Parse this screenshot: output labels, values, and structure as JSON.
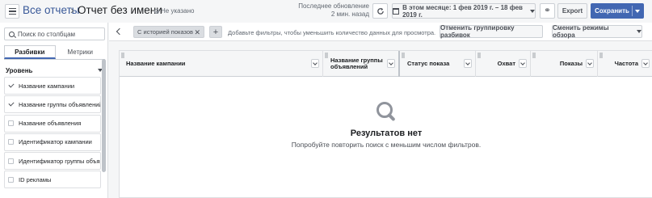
{
  "header": {
    "breadcrumb_link": "Все отчеты",
    "breadcrumb_sep": "›",
    "title": "Отчет без имени",
    "status": "Не указано",
    "updated_line1": "Последнее обновление",
    "updated_line2": "2 мин. назад",
    "date_range": "В этом месяце: 1 фев 2019 г. – 18 фев 2019 г.",
    "link_icon": "⚭",
    "export_label": "Export",
    "save_label": "Сохранить"
  },
  "sidebar": {
    "search_placeholder": "Поиск по столбцам",
    "tabs": [
      {
        "label": "Разбивки",
        "active": true
      },
      {
        "label": "Метрики",
        "active": false
      }
    ],
    "level_label": "Уровень",
    "items": [
      {
        "label": "Название кампании",
        "checked": true
      },
      {
        "label": "Название группы объявлений",
        "checked": true
      },
      {
        "label": "Название объявления",
        "checked": false
      },
      {
        "label": "Идентификатор кампании",
        "checked": false
      },
      {
        "label": "Идентификатор группы объяв...",
        "checked": false
      },
      {
        "label": "ID рекламы",
        "checked": false
      }
    ]
  },
  "filters": {
    "chip_label": "С историей показов",
    "chip_remove": "✕",
    "add": "+",
    "hint": "Добавьте фильтры, чтобы уменьшить количество данных для просмотра.",
    "cancel_grouping": "Отменить группировку разбивок",
    "change_modes": "Сменить режимы обзора"
  },
  "table": {
    "columns": [
      {
        "label": "Название кампании"
      },
      {
        "label": "Название группы объявлений"
      },
      {
        "label": "Статус показа"
      },
      {
        "label": "Охват"
      },
      {
        "label": "Показы"
      },
      {
        "label": "Частота"
      }
    ],
    "empty_title": "Результатов нет",
    "empty_subtitle": "Попробуйте повторить поиск с меньшим числом фильтров."
  },
  "colors": {
    "accent": "#4267b2",
    "link": "#385898"
  }
}
